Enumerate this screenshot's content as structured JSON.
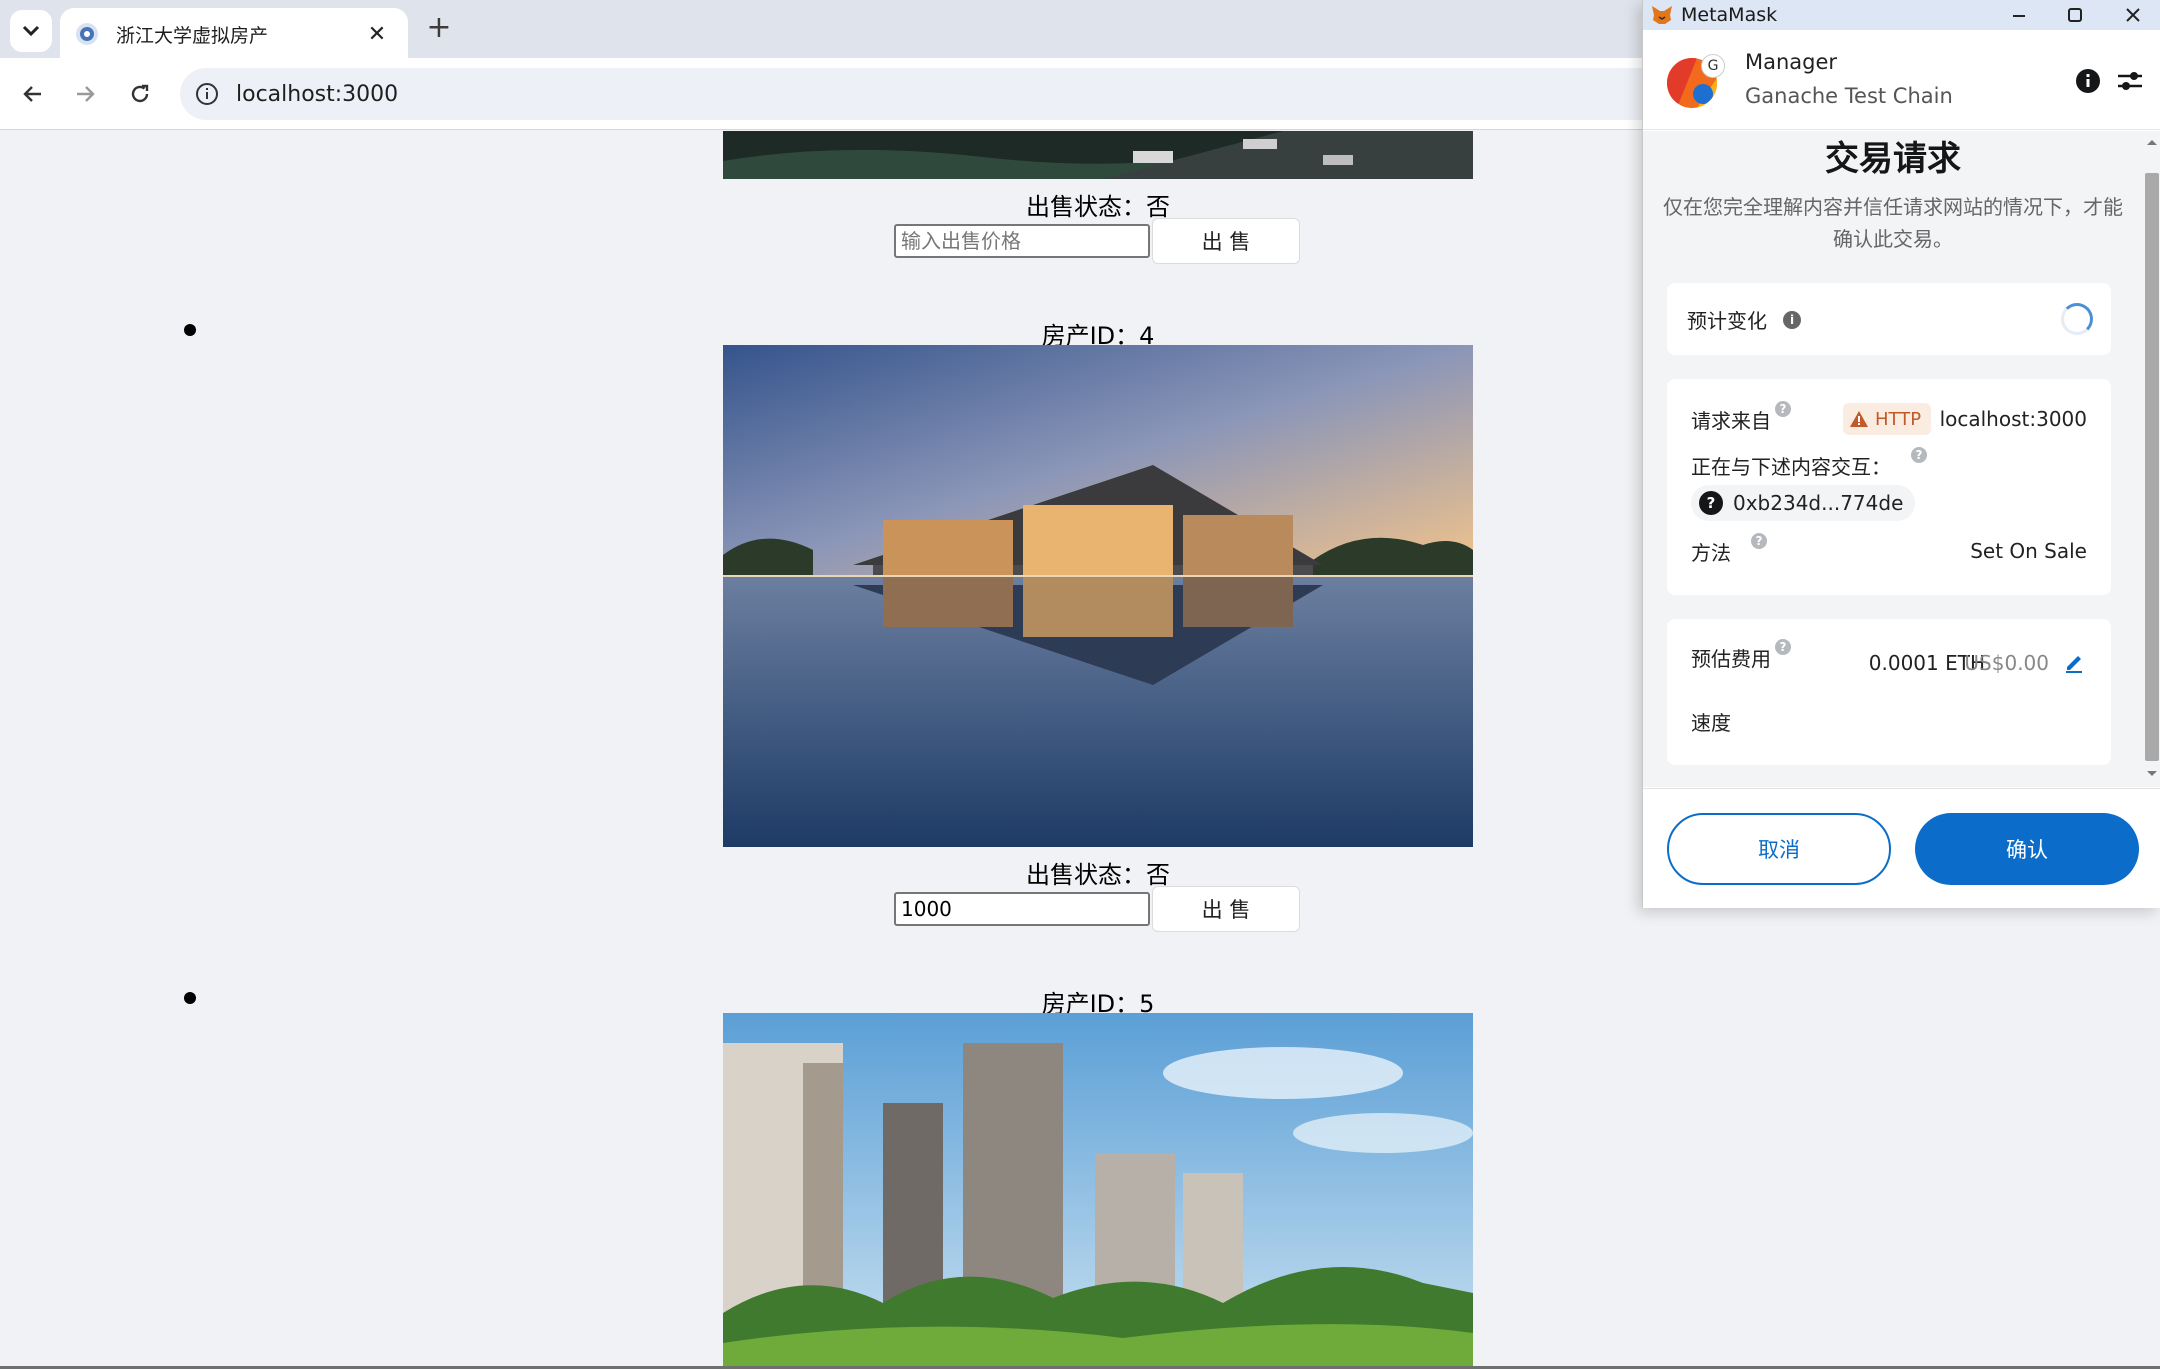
{
  "browser": {
    "tab_title": "浙江大学虚拟房产",
    "url": "localhost:3000"
  },
  "page": {
    "listings": [
      {
        "status_label": "出售状态：否",
        "price_placeholder": "输入出售价格",
        "price_value": "",
        "sell_label": "出 售"
      },
      {
        "title": "房产ID：4",
        "status_label": "出售状态：否",
        "price_placeholder": "输入出售价格",
        "price_value": "1000",
        "sell_label": "出 售"
      },
      {
        "title": "房产ID：5"
      }
    ]
  },
  "metamask": {
    "window_title": "MetaMask",
    "account": {
      "name": "Manager",
      "network": "Ganache Test Chain",
      "badge": "G"
    },
    "heading": "交易请求",
    "subtitle": "仅在您完全理解内容并信任请求网站的情况下，才能确认此交易。",
    "estimated_changes_label": "预计变化",
    "request_from_label": "请求来自",
    "protocol_badge": "HTTP",
    "origin": "localhost:3000",
    "interacting_label": "正在与下述内容交互：",
    "contract_address": "0xb234d...774de",
    "method_label": "方法",
    "method_value": "Set On Sale",
    "fee_label": "预估费用",
    "fee_eth": "0.0001 ETH",
    "fee_usd": "US$0.00",
    "speed_label": "速度",
    "cancel_label": "取消",
    "confirm_label": "确认"
  },
  "colors": {
    "accent": "#0b6dc9",
    "page_bg": "#f1f2f5",
    "warning": "#c1592a"
  }
}
